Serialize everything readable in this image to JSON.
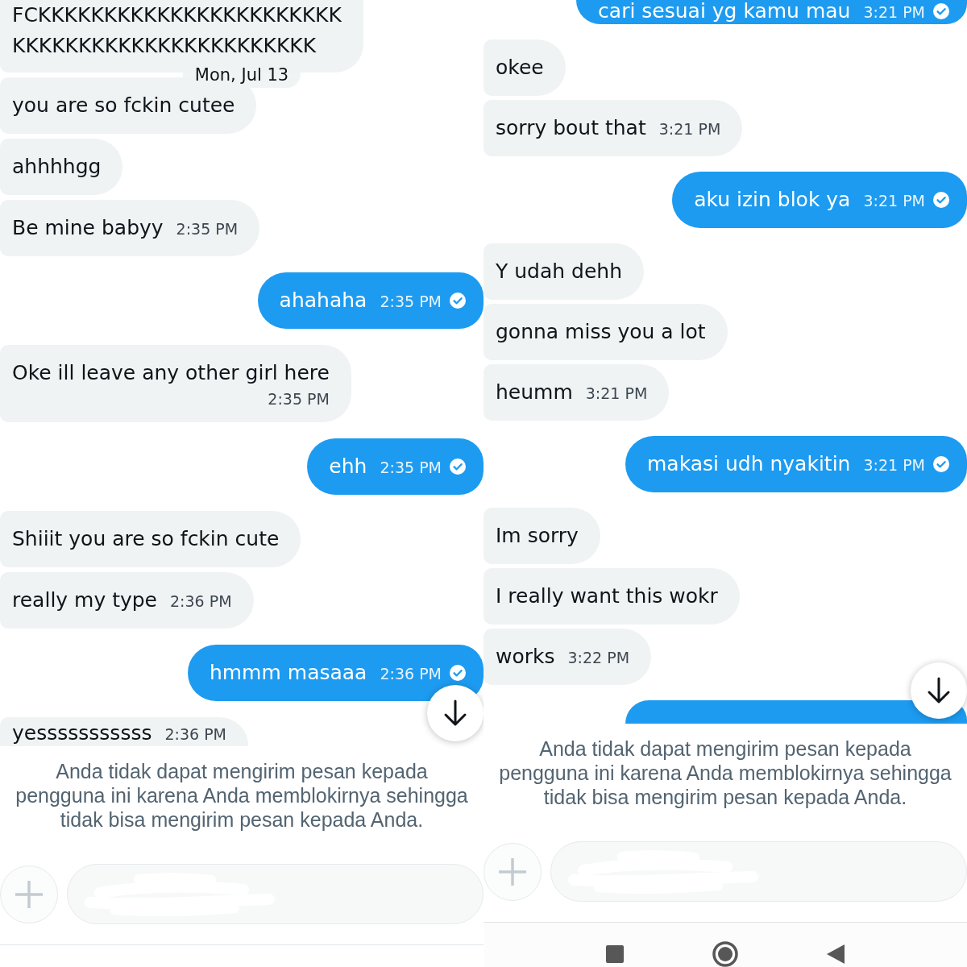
{
  "panels": [
    {
      "date_chip": "Mon, Jul 13",
      "messages": [
        {
          "kind": "received",
          "text": "FCKKKKKKKKKKKKKKKKKKKKKKK\nKKKKKKKKKKKKKKKKKKKKKKK",
          "clipped_top": true
        },
        {
          "kind": "received",
          "text": "you are so fckin cutee"
        },
        {
          "kind": "received",
          "text": "ahhhhgg"
        },
        {
          "kind": "received",
          "text": "Be mine babyy",
          "time": "2:35 PM"
        },
        {
          "kind": "sent",
          "text": "ahahaha",
          "time": "2:35 PM"
        },
        {
          "kind": "received",
          "text": "Oke ill leave any other girl here",
          "time": "2:35 PM",
          "time_below": true
        },
        {
          "kind": "sent",
          "text": "ehh",
          "time": "2:35 PM"
        },
        {
          "kind": "received",
          "text": "Shiiit you are so fckin cute"
        },
        {
          "kind": "received",
          "text": "really my type",
          "time": "2:36 PM"
        },
        {
          "kind": "sent",
          "text": "hmmm masaaa",
          "time": "2:36 PM"
        },
        {
          "kind": "received",
          "text": "yesssssssssss",
          "time": "2:36 PM",
          "clipped_bottom": true
        }
      ],
      "notice": "Anda tidak dapat mengirim pesan kepada pengguna ini karena Anda memblokirnya sehingga tidak bisa mengirim pesan kepada Anda.",
      "composer": {
        "disabled": true
      }
    },
    {
      "messages": [
        {
          "kind": "sent",
          "text": "cari sesuai yg kamu mau",
          "time": "3:21 PM",
          "clipped_top": true
        },
        {
          "kind": "received",
          "text": "okee"
        },
        {
          "kind": "received",
          "text": "sorry bout that",
          "time": "3:21 PM"
        },
        {
          "kind": "sent",
          "text": "aku izin blok ya",
          "time": "3:21 PM"
        },
        {
          "kind": "received",
          "text": "Y udah dehh"
        },
        {
          "kind": "received",
          "text": "gonna miss you a lot"
        },
        {
          "kind": "received",
          "text": "heumm",
          "time": "3:21 PM"
        },
        {
          "kind": "sent",
          "text": "makasi udh nyakitin",
          "time": "3:21 PM"
        },
        {
          "kind": "received",
          "text": "Im sorry"
        },
        {
          "kind": "received",
          "text": "I really want this wokr"
        },
        {
          "kind": "received",
          "text": "works",
          "time": "3:22 PM"
        },
        {
          "kind": "sent",
          "clipped_bottom": true
        }
      ],
      "notice": "Anda tidak dapat mengirim pesan kepada pengguna ini karena Anda memblokirnya sehingga tidak bisa mengirim pesan kepada Anda.",
      "composer": {
        "disabled": true
      },
      "system_nav": true
    }
  ]
}
